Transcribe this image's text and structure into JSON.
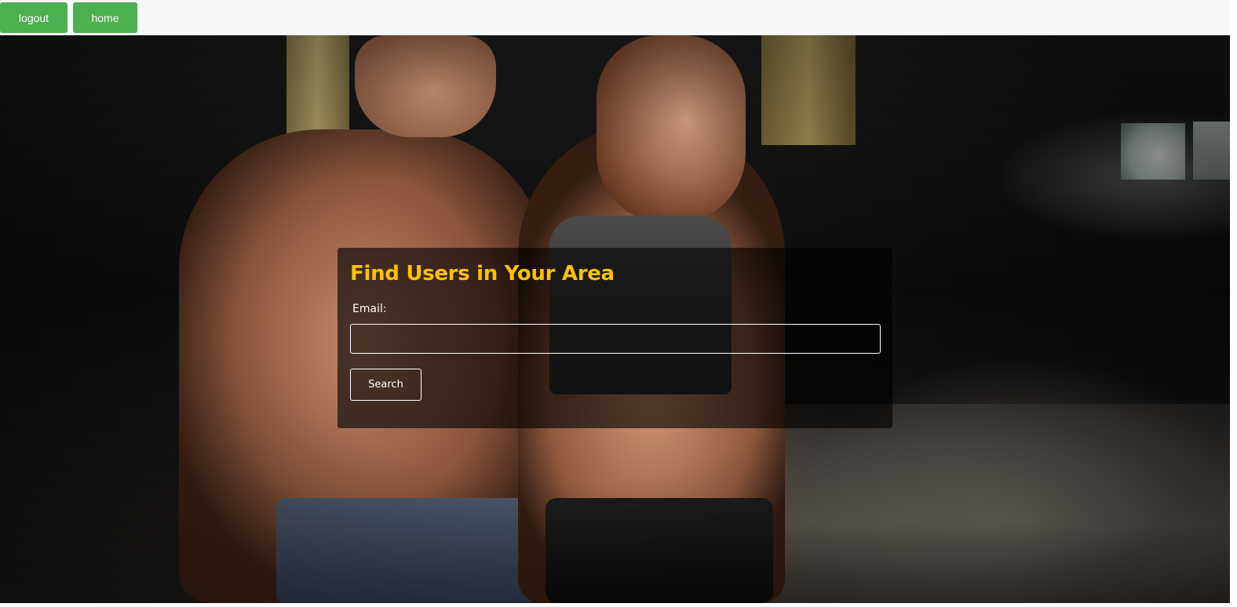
{
  "nav": {
    "logout_label": "logout",
    "home_label": "home",
    "button_color": "#4caf50"
  },
  "hero": {
    "image_semantic": "gym-couple-background-photo"
  },
  "search": {
    "title": "Find Users in Your Area",
    "title_color": "#ffc107",
    "email_label": "Email:",
    "email_value": "",
    "search_label": "Search"
  }
}
